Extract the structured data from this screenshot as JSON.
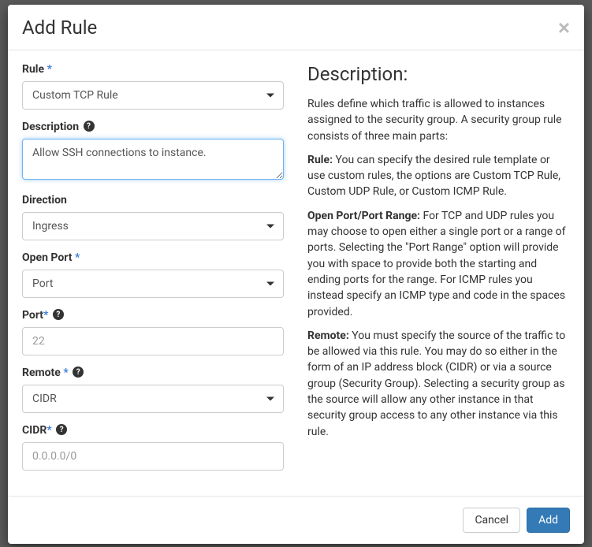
{
  "modal": {
    "title": "Add Rule",
    "close_symbol": "×"
  },
  "form": {
    "rule": {
      "label": "Rule",
      "value": "Custom TCP Rule"
    },
    "description": {
      "label": "Description",
      "value": "Allow SSH connections to instance."
    },
    "direction": {
      "label": "Direction",
      "value": "Ingress"
    },
    "open_port": {
      "label": "Open Port",
      "value": "Port"
    },
    "port": {
      "label": "Port",
      "placeholder": "22"
    },
    "remote": {
      "label": "Remote",
      "value": "CIDR"
    },
    "cidr": {
      "label": "CIDR",
      "placeholder": "0.0.0.0/0"
    }
  },
  "help": {
    "title": "Description:",
    "intro": "Rules define which traffic is allowed to instances assigned to the security group. A security group rule consists of three main parts:",
    "rule_label": "Rule:",
    "rule_text": " You can specify the desired rule template or use custom rules, the options are Custom TCP Rule, Custom UDP Rule, or Custom ICMP Rule.",
    "port_label": "Open Port/Port Range:",
    "port_text": " For TCP and UDP rules you may choose to open either a single port or a range of ports. Selecting the \"Port Range\" option will provide you with space to provide both the starting and ending ports for the range. For ICMP rules you instead specify an ICMP type and code in the spaces provided.",
    "remote_label": "Remote:",
    "remote_text": " You must specify the source of the traffic to be allowed via this rule. You may do so either in the form of an IP address block (CIDR) or via a source group (Security Group). Selecting a security group as the source will allow any other instance in that security group access to any other instance via this rule."
  },
  "footer": {
    "cancel": "Cancel",
    "add": "Add"
  }
}
